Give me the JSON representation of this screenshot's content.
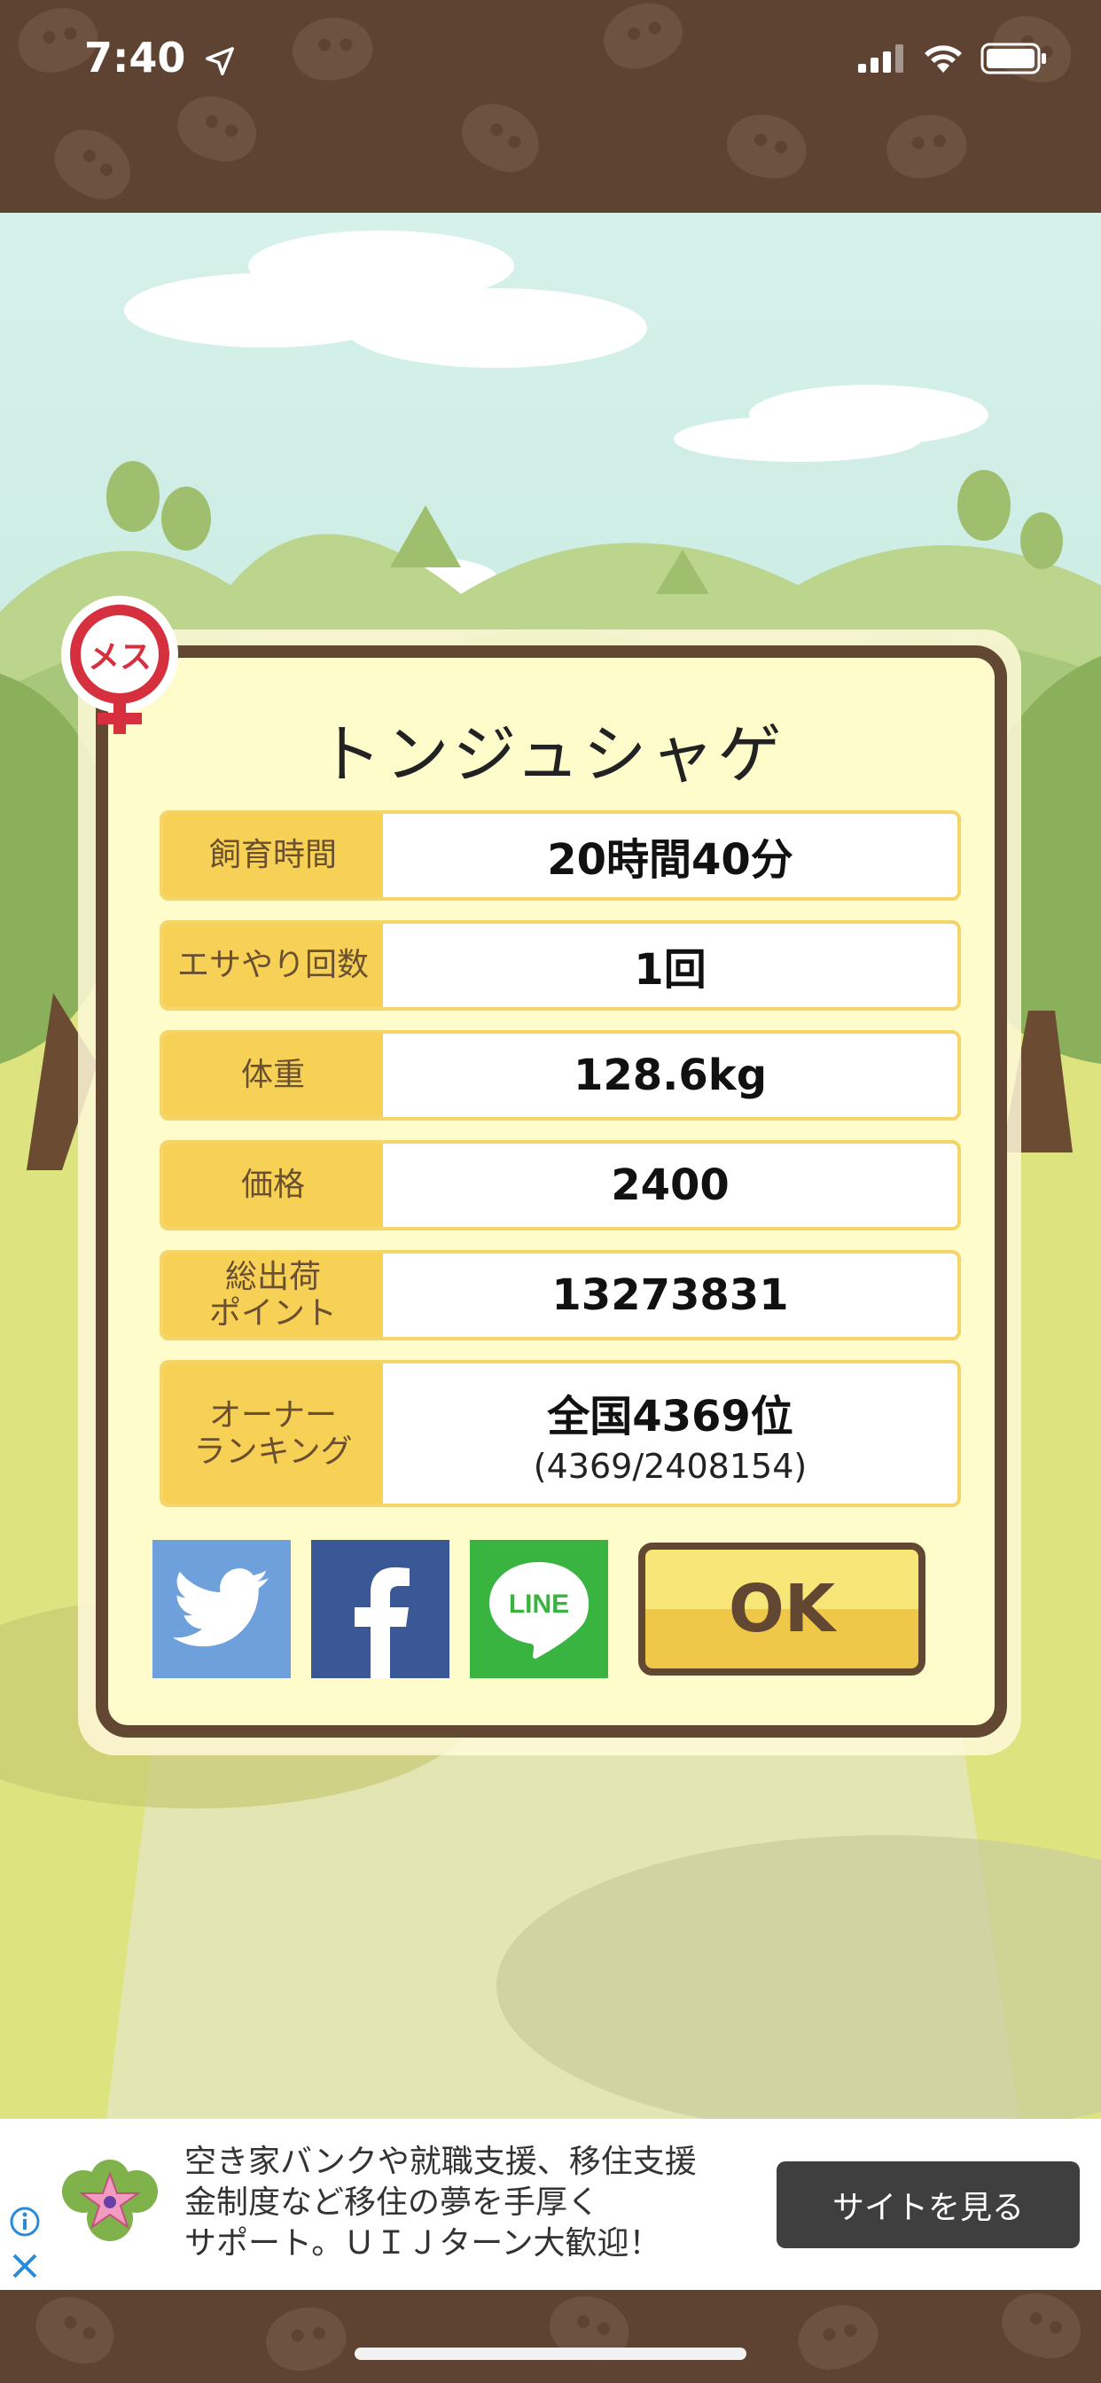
{
  "status_bar": {
    "time": "7:40"
  },
  "dialog": {
    "title": "トンジュシャゲ",
    "gender_badge": "メス",
    "rows": [
      {
        "label": "飼育時間",
        "value": "20時間40分"
      },
      {
        "label": "エサやり回数",
        "value": "1回"
      },
      {
        "label": "体重",
        "value": "128.6kg"
      },
      {
        "label": "価格",
        "value": "2400"
      },
      {
        "label_line1": "総出荷",
        "label_line2": "ポイント",
        "value": "13273831"
      },
      {
        "label_line1": "オーナー",
        "label_line2": "ランキング",
        "value": "全国4369位",
        "sub": "(4369/2408154)"
      }
    ],
    "share": {
      "line_text": "LINE"
    },
    "ok_label": "OK"
  },
  "ad": {
    "line1": "空き家バンクや就職支援、移住支援",
    "line2": "金制度など移住の夢を手厚く",
    "line3": "サポート。ＵＩＪターン大歓迎！",
    "button_label": "サイトを見る"
  },
  "colors": {
    "frame_brown": "#624833",
    "label_yellow": "#f7d156",
    "panel_cream": "#fffccc",
    "twitter": "#6ea1dc",
    "facebook": "#3b5896",
    "line": "#3ab440",
    "gender_red": "#d6303f"
  },
  "icons": [
    "location-arrow-icon",
    "cellular-signal-icon",
    "wifi-icon",
    "battery-icon",
    "twitter-icon",
    "facebook-icon",
    "line-icon",
    "female-icon",
    "info-icon",
    "close-icon",
    "flower-logo-icon"
  ]
}
